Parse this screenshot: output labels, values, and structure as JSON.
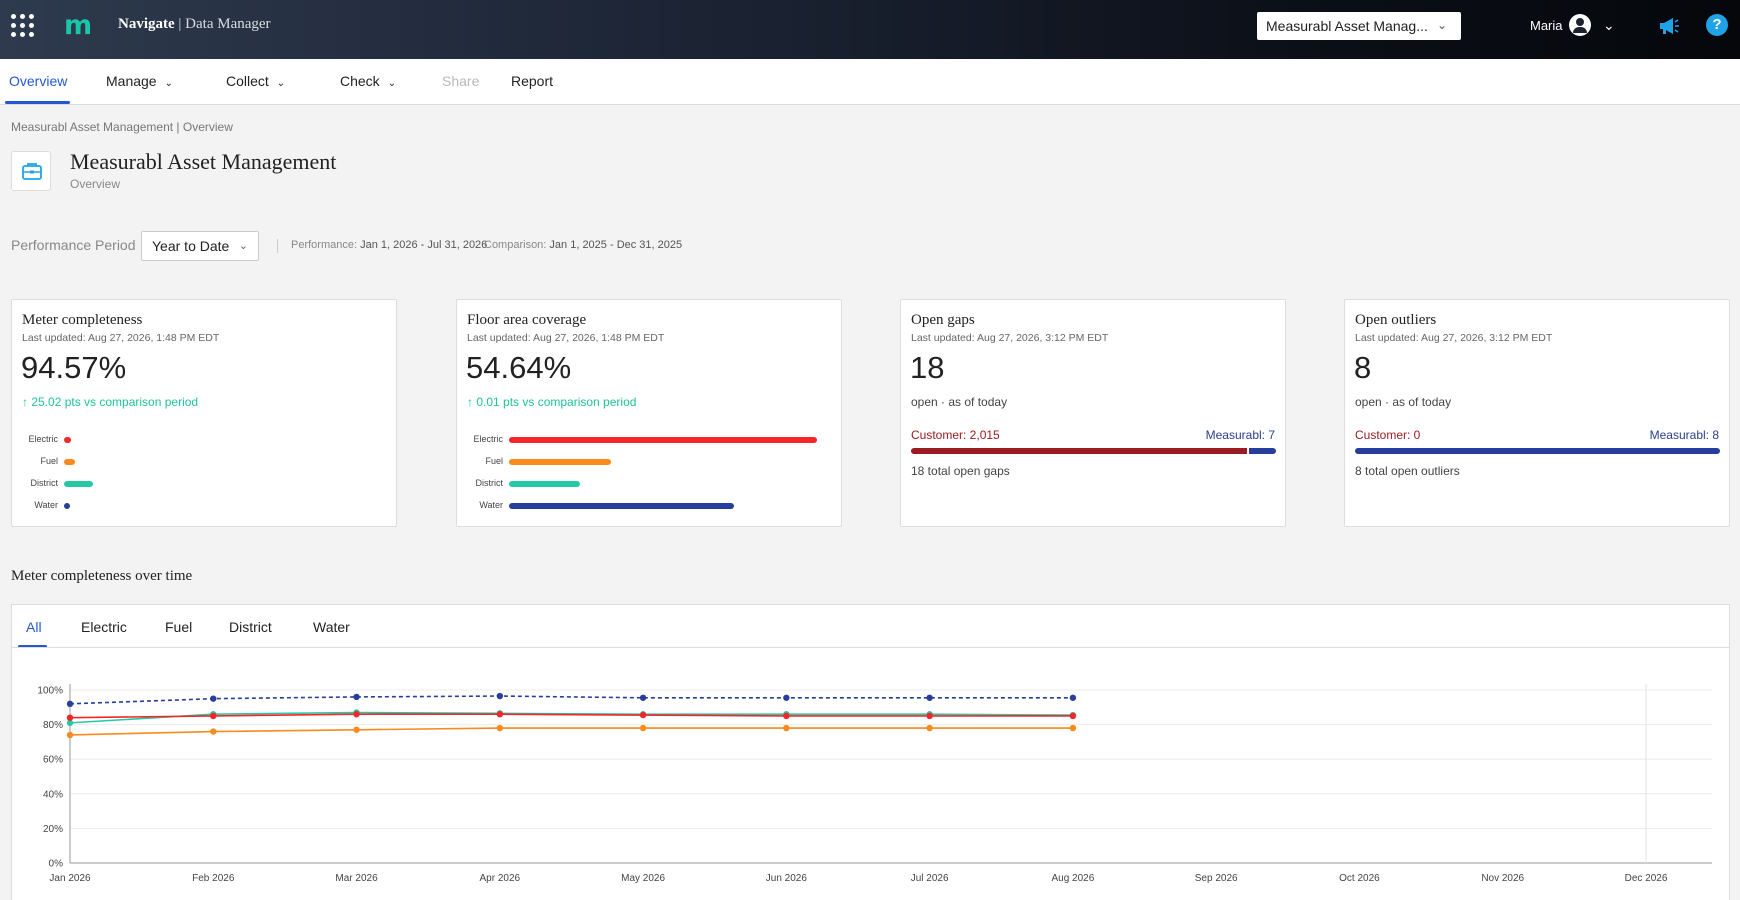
{
  "header": {
    "logo": "m",
    "app_name": "Navigate",
    "app_sep": " | ",
    "app_section": "Data Manager",
    "org_select": "Measurabl Asset Manag...",
    "user_name": "Maria",
    "help_glyph": "?"
  },
  "nav": {
    "overview": "Overview",
    "manage": "Manage",
    "collect": "Collect",
    "check": "Check",
    "share": "Share",
    "report": "Report"
  },
  "breadcrumb": "Measurabl Asset Management | Overview",
  "page": {
    "title": "Measurabl Asset Management",
    "subtitle": "Overview"
  },
  "period": {
    "label": "Performance Period",
    "selected": "Year to Date",
    "performance_label": "Performance:",
    "performance_range": "Jan 1, 2026 - Jul 31, 2026",
    "comparison_label": "Comparison:",
    "comparison_range": "Jan 1, 2025 - Dec 31, 2025"
  },
  "colors": {
    "electric": "#f2262b",
    "fuel": "#f98a1c",
    "district": "#27c9a4",
    "water": "#263f9c",
    "customer": "#9b1c20",
    "accent": "#2458d3"
  },
  "cards": {
    "meter": {
      "title": "Meter completeness",
      "updated": "Last updated: Aug 27, 2026, 1:48 PM EDT",
      "value": "94.57%",
      "delta": "↑ 25.02 pts vs comparison period",
      "bars": [
        {
          "label": "Electric",
          "value": 0.02
        },
        {
          "label": "Fuel",
          "value": 0.035
        },
        {
          "label": "District",
          "value": 0.09
        },
        {
          "label": "Water",
          "value": 0.015
        }
      ]
    },
    "floor": {
      "title": "Floor area coverage",
      "updated": "Last updated: Aug 27, 2026, 1:48 PM EDT",
      "value": "54.64%",
      "delta": "↑ 0.01 pts vs comparison period",
      "bars": [
        {
          "label": "Electric",
          "value": 1.0
        },
        {
          "label": "Fuel",
          "value": 0.33
        },
        {
          "label": "District",
          "value": 0.23
        },
        {
          "label": "Water",
          "value": 0.73
        }
      ]
    },
    "gaps": {
      "title": "Open gaps",
      "updated": "Last updated: Aug 27, 2026, 3:12 PM EDT",
      "value": "18",
      "note": "open · as of today",
      "customer_label": "Customer: 2,015",
      "measurabl_label": "Measurabl: 7",
      "customer_share": 0.92,
      "total": "18 total open gaps"
    },
    "outliers": {
      "title": "Open outliers",
      "updated": "Last updated: Aug 27, 2026, 3:12 PM EDT",
      "value": "8",
      "note": "open · as of today",
      "customer_label": "Customer: 0",
      "measurabl_label": "Measurabl: 8",
      "customer_share": 0.0,
      "total": "8 total open outliers"
    }
  },
  "section_title": "Meter completeness over time",
  "tabs": [
    "All",
    "Electric",
    "Fuel",
    "District",
    "Water"
  ],
  "chart_data": {
    "type": "line",
    "x": [
      "Jan 2026",
      "Feb 2026",
      "Mar 2026",
      "Apr 2026",
      "May 2026",
      "Jun 2026",
      "Jul 2026",
      "Aug 2026",
      "Sep 2026",
      "Oct 2026",
      "Nov 2026",
      "Dec 2026"
    ],
    "ylim": [
      0,
      100
    ],
    "yticks": [
      "0%",
      "20%",
      "40%",
      "60%",
      "80%",
      "100%"
    ],
    "grid": true,
    "series": [
      {
        "key": "water",
        "style": "dashed",
        "values": [
          92,
          95,
          96,
          96.5,
          95.5,
          95.5,
          95.5,
          95.5
        ]
      },
      {
        "key": "district",
        "style": "solid",
        "values": [
          81,
          86,
          87,
          86.5,
          86,
          86,
          86,
          85.5
        ]
      },
      {
        "key": "electric",
        "style": "solid",
        "values": [
          84,
          85,
          86,
          86,
          85.5,
          85,
          85,
          85
        ]
      },
      {
        "key": "fuel",
        "style": "solid",
        "values": [
          74,
          76,
          77,
          78,
          78,
          78,
          78,
          78
        ]
      }
    ]
  }
}
